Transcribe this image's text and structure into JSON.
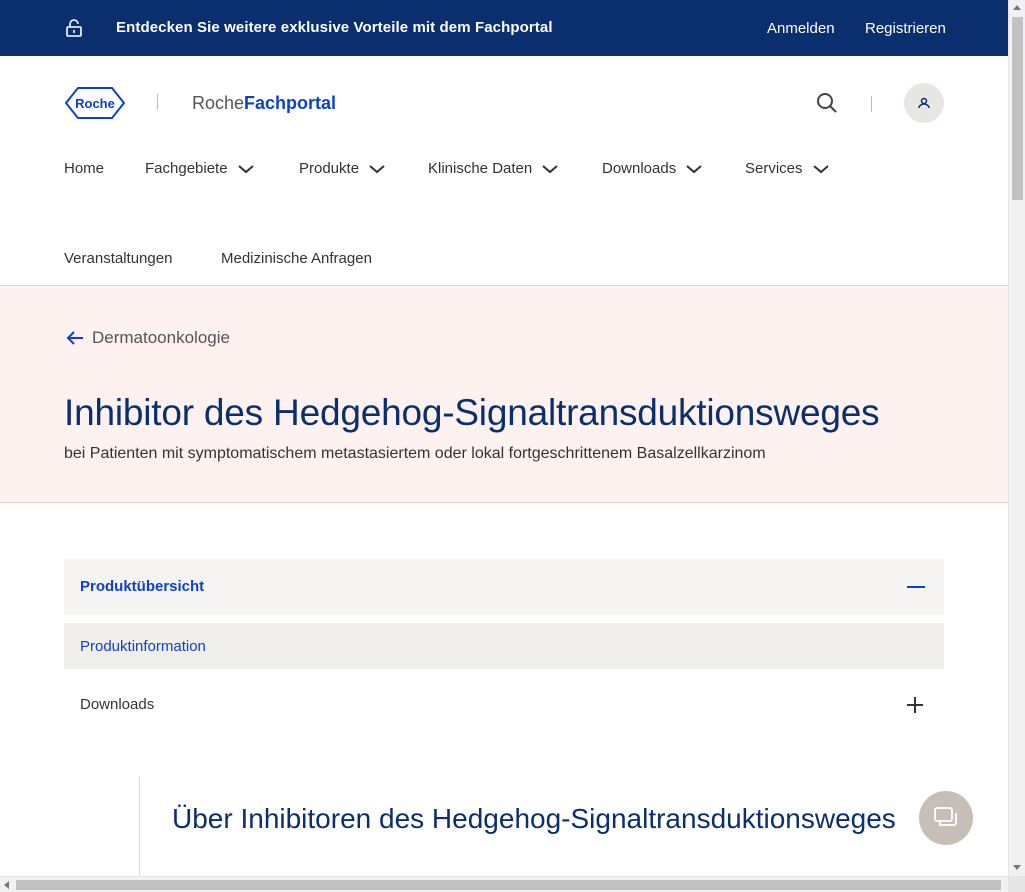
{
  "topbar": {
    "promo": "Entdecken Sie weitere exklusive Vorteile mit dem Fachportal",
    "login": "Anmelden",
    "register": "Registrieren"
  },
  "header": {
    "logo_text": "Roche",
    "portal_prefix": "Roche",
    "portal_bold": "Fachportal"
  },
  "nav": {
    "row1": [
      {
        "label": "Home",
        "dropdown": false
      },
      {
        "label": "Fachgebiete",
        "dropdown": true
      },
      {
        "label": "Produkte",
        "dropdown": true
      },
      {
        "label": "Klinische Daten",
        "dropdown": true
      },
      {
        "label": "Downloads",
        "dropdown": true
      },
      {
        "label": "Services",
        "dropdown": true
      }
    ],
    "row2": [
      {
        "label": "Veranstaltungen"
      },
      {
        "label": "Medizinische Anfragen"
      }
    ]
  },
  "hero": {
    "back_label": "Dermatoonkologie",
    "title": "Inhibitor des Hedgehog-Signaltransduktionsweges",
    "subtitle": "bei Patienten mit symptomatischem metastasiertem oder lokal fortgeschrittenem Basalzellkarzinom"
  },
  "accordion": {
    "section1_label": "Produktübersicht",
    "section1_sub": "Produktinformation",
    "section2_label": "Downloads"
  },
  "content": {
    "heading": "Über Inhibitoren des Hedgehog-Signaltransduktionsweges"
  },
  "colors": {
    "brand_navy": "#0b2e6f",
    "link_blue": "#0b41cd",
    "hero_bg": "#fdf2f0"
  }
}
